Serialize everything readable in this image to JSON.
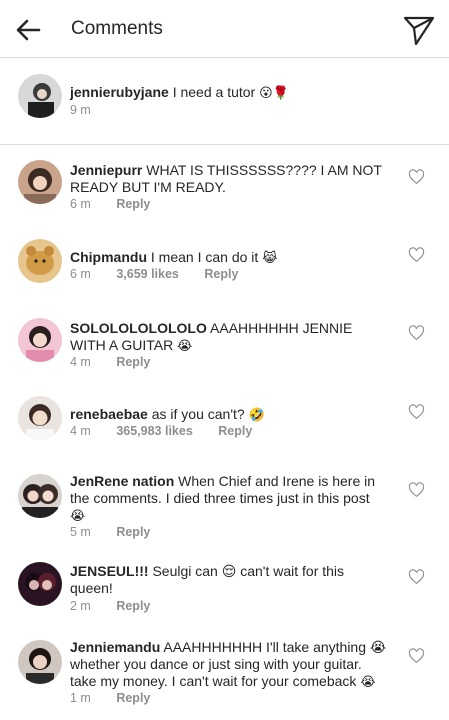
{
  "header": {
    "title": "Comments",
    "back_icon": "arrow-left-icon",
    "send_icon": "paper-plane-icon"
  },
  "caption": {
    "username": "jennierubyjane",
    "text": "I need a tutor",
    "emojis": "😮🌹",
    "time": "9 m"
  },
  "comments": [
    {
      "username": "Jenniepurr",
      "text": "WHAT IS THISSSSSS???? I AM NOT READY BUT I'M READY.",
      "emoji": "",
      "time": "6 m",
      "likes": "",
      "reply": "Reply"
    },
    {
      "username": "Chipmandu",
      "text": "I mean I can do it",
      "emoji": "😹",
      "time": "6 m",
      "likes": "3,659 likes",
      "reply": "Reply"
    },
    {
      "username": "SOLOLOLOLOLOLO",
      "text": "AAAHHHHHH JENNIE WITH A GUITAR",
      "emoji": "😭",
      "time": "4 m",
      "likes": "",
      "reply": "Reply"
    },
    {
      "username": "renebaebae",
      "text": "as if you can't?",
      "emoji": "🤣",
      "time": "4 m",
      "likes": "365,983 likes",
      "reply": "Reply"
    },
    {
      "username": "JenRene nation",
      "text": "When Chief and Irene is here in the comments. I died three times just in this post",
      "emoji": "😭",
      "time": "5 m",
      "likes": "",
      "reply": "Reply"
    },
    {
      "username": "JENSEUL!!!",
      "text": "Seulgi can 😌 can't wait for this queen!",
      "emoji": "",
      "time": "2 m",
      "likes": "",
      "reply": "Reply"
    },
    {
      "username": "Jenniemandu",
      "text": "AAAHHHHHHH I'll take anything 😭 whether you dance or just sing with your guitar. take my money. I can't wait for your comeback",
      "emoji": "😭",
      "time": "1 m",
      "likes": "",
      "reply": "Reply"
    }
  ]
}
